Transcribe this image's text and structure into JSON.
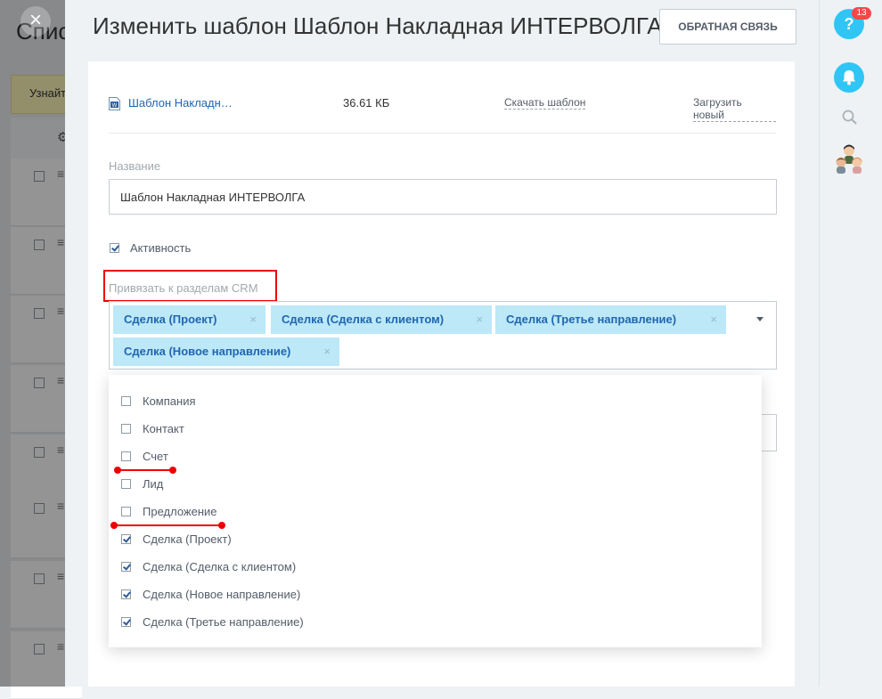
{
  "background": {
    "title": "Спис",
    "banner_text": "Узнайт"
  },
  "slider": {
    "title": "Изменить шаблон Шаблон Накладная ИНТЕРВОЛГА",
    "feedback_label": "ОБРАТНАЯ СВЯЗЬ"
  },
  "file": {
    "name": "Шаблон Накладн…",
    "size": "36.61 КБ",
    "download_label": "Скачать шаблон",
    "upload_label": "Загрузить новый"
  },
  "form": {
    "name_label": "Название",
    "name_value": "Шаблон Накладная ИНТЕРВОЛГА",
    "active_label": "Активность",
    "active_checked": true,
    "crm_label": "Привязать к разделам CRM",
    "selected_tags": [
      "Сделка (Проект)",
      "Сделка (Сделка с клиентом)",
      "Сделка (Третье направление)",
      "Сделка (Новое направление)"
    ],
    "remove_tag_symbol": "×"
  },
  "dropdown": {
    "options": [
      {
        "label": "Компания",
        "checked": false
      },
      {
        "label": "Контакт",
        "checked": false
      },
      {
        "label": "Счет",
        "checked": false
      },
      {
        "label": "Лид",
        "checked": false
      },
      {
        "label": "Предложение",
        "checked": false
      },
      {
        "label": "Сделка (Проект)",
        "checked": true
      },
      {
        "label": "Сделка (Сделка с клиентом)",
        "checked": true
      },
      {
        "label": "Сделка (Новое направление)",
        "checked": true
      },
      {
        "label": "Сделка (Третье направление)",
        "checked": true
      }
    ]
  },
  "right_panel": {
    "help_symbol": "?",
    "notification_count": "13"
  },
  "colors": {
    "accent": "#2fc6f6",
    "tag_bg": "#bce8f8",
    "link": "#2067b0",
    "annotation": "#ee0000",
    "badge": "#f44848"
  },
  "icons": [
    "close-icon",
    "file-icon",
    "help-icon",
    "bell-icon",
    "search-icon",
    "chevron-down-icon",
    "remove-tag-icon",
    "settings-gear-icon"
  ]
}
